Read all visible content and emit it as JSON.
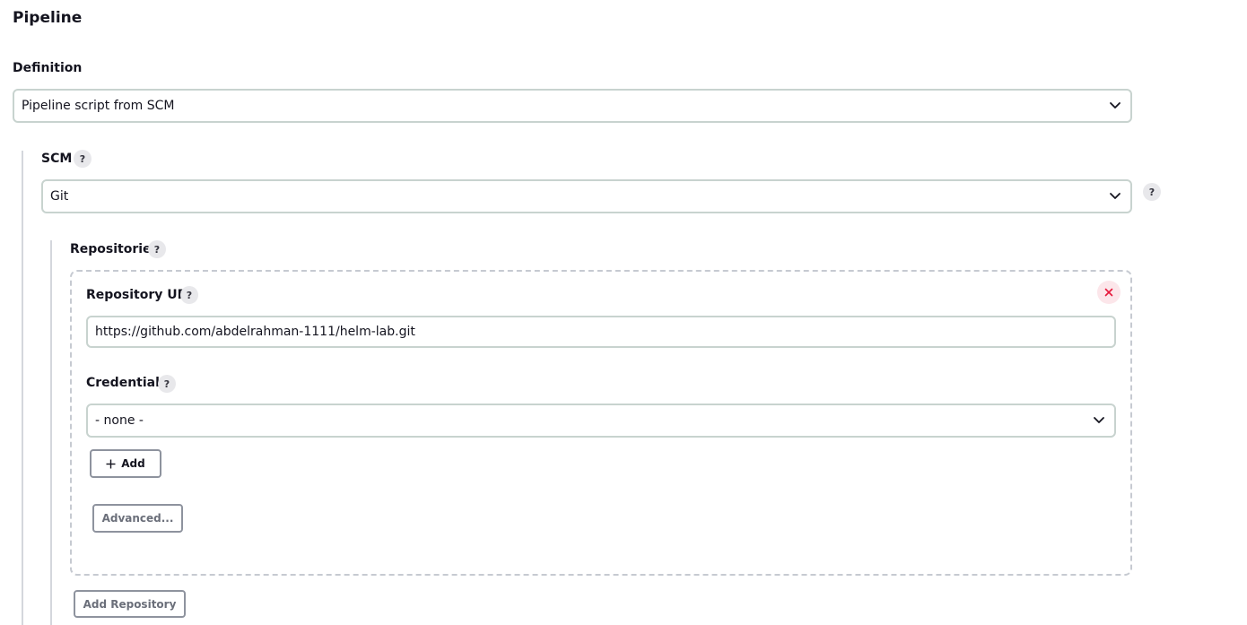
{
  "pipeline": {
    "title": "Pipeline",
    "definition_label": "Definition",
    "definition_value": "Pipeline script from SCM"
  },
  "scm": {
    "label": "SCM",
    "value": "Git",
    "help": "?"
  },
  "repositories": {
    "label": "Repositories",
    "help": "?",
    "repository_url_label": "Repository URL",
    "repository_url_value": "https://github.com/abdelrahman-1111/helm-lab.git",
    "credentials_label": "Credentials",
    "credentials_value": "- none -",
    "add_label": "Add",
    "advanced_label": "Advanced...",
    "add_repository_label": "Add Repository"
  },
  "icons": {
    "help": "question-mark-icon",
    "chevron": "chevron-down-icon",
    "close": "close-icon",
    "plus": "plus-icon"
  },
  "colors": {
    "close_red": "#e6193c",
    "close_bg": "#fce6ea",
    "border": "#c8d3cf"
  }
}
